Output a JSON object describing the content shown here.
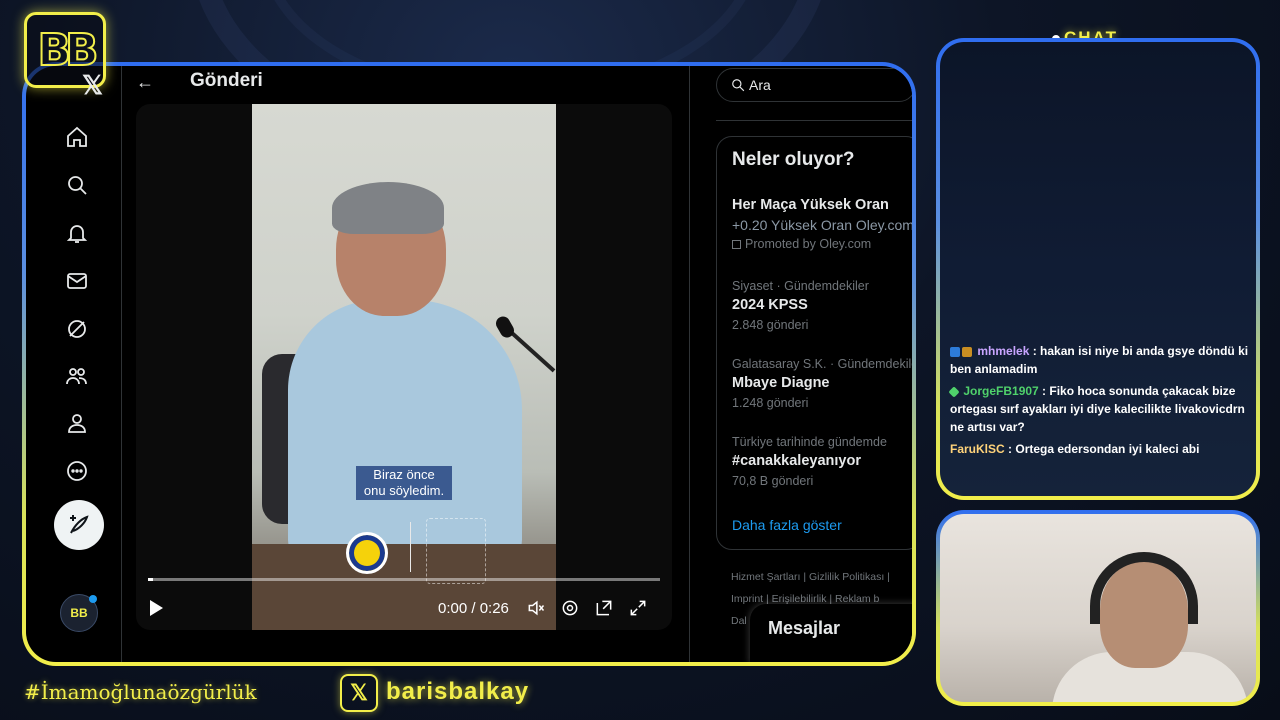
{
  "overlay": {
    "chat_label": "CHAT",
    "hashtag": "#İmamoğlunaözgürlük",
    "handle": "barisbalkay",
    "accent_color": "#f2ee4a",
    "frame_color": "#2f6df0"
  },
  "x_app": {
    "nav_icons": [
      "home-icon",
      "search-icon",
      "bell-icon",
      "mail-icon",
      "grok-icon",
      "communities-icon",
      "profile-icon",
      "more-icon"
    ],
    "header": {
      "back": "←",
      "title": "Gönderi"
    },
    "video": {
      "subtitle_line1": "Biraz önce",
      "subtitle_line2": "onu söyledim.",
      "time": "0:00 / 0:26",
      "progress": 0.0
    },
    "search": {
      "placeholder": "Ara"
    },
    "trends": {
      "title": "Neler oluyor?",
      "items": [
        {
          "meta": "",
          "name": "Her Maça Yüksek Oran",
          "count": "+0.20 Yüksek Oran Oley.com",
          "promo": "Promoted by Oley.com"
        },
        {
          "meta": "Siyaset · Gündemdekiler",
          "name": "2024 KPSS",
          "count": "2.848 gönderi"
        },
        {
          "meta": "Galatasaray S.K. · Gündemdekiler",
          "name": "Mbaye Diagne",
          "count": "1.248 gönderi"
        },
        {
          "meta": "Türkiye tarihinde gündemde",
          "name": "#canakkaleyanıyor",
          "count": "70,8 B gönderi"
        }
      ],
      "show_more": "Daha fazla göster"
    },
    "footer": {
      "line1": "Hizmet Şartları  |  Gizlilik Politikası  |",
      "line2": "Imprint  |  Erişilebilirlik  |  Reklam b",
      "line3": "Dal"
    },
    "messages": "Mesajlar"
  },
  "chat": {
    "messages": [
      {
        "user": "mhmelek",
        "text": "hakan isi niye bi anda gsye döndü ki ben anlamadim"
      },
      {
        "user": "JorgeFB1907",
        "text": "Fiko hoca sonunda çakacak bize ortegası sırf ayakları iyi diye kalecilikte livakovicdrn ne artısı var?"
      },
      {
        "user": "FaruKlSC",
        "text": "Ortega edersondan iyi kaleci abi"
      }
    ]
  }
}
